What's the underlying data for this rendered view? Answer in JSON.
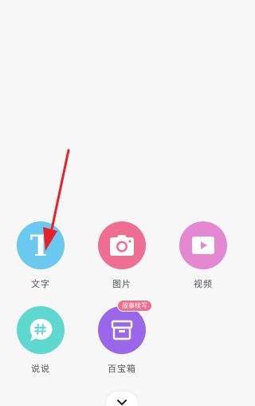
{
  "menu": {
    "items": [
      {
        "label": "文字",
        "icon": "text-t-icon",
        "color": "#6bc8ef"
      },
      {
        "label": "图片",
        "icon": "camera-icon",
        "color": "#ef6e93"
      },
      {
        "label": "视频",
        "icon": "video-play-icon",
        "color": "#e488d2"
      },
      {
        "label": "说说",
        "icon": "chat-hash-icon",
        "color": "#5fd9d0"
      },
      {
        "label": "百宝箱",
        "icon": "treasure-box-icon",
        "color": "#9a67e8",
        "badge": "故事续写"
      }
    ],
    "text_icon_glyph": "T"
  },
  "collapse": {
    "icon": "chevron-down-icon"
  },
  "annotation": {
    "color": "#e8202a"
  }
}
